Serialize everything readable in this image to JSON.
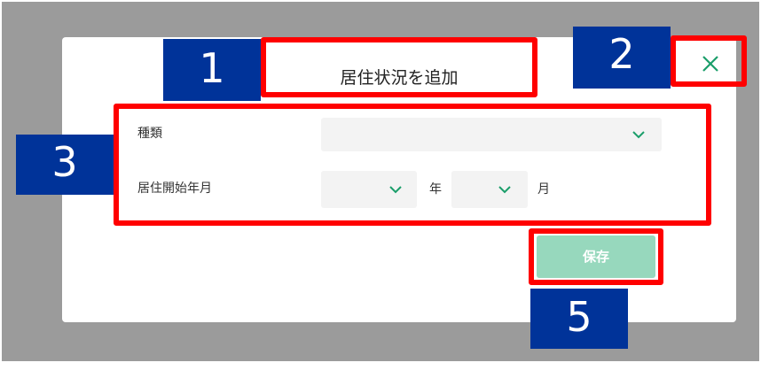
{
  "modal": {
    "title": "居住状況を追加",
    "close_icon": "close-icon",
    "fields": {
      "type_label": "種類",
      "type_value": "",
      "start_label": "居住開始年月",
      "year_value": "",
      "year_unit": "年",
      "month_value": "",
      "month_unit": "月"
    },
    "save_label": "保存"
  },
  "annotations": {
    "badge_1": "1",
    "badge_2": "2",
    "badge_3": "3",
    "badge_5": "5"
  },
  "colors": {
    "overlay": "#9b9b9b",
    "accent_green": "#1a9e6a",
    "save_button": "#97d8bd",
    "highlight_red": "#ff0000",
    "badge_blue": "#003399"
  }
}
